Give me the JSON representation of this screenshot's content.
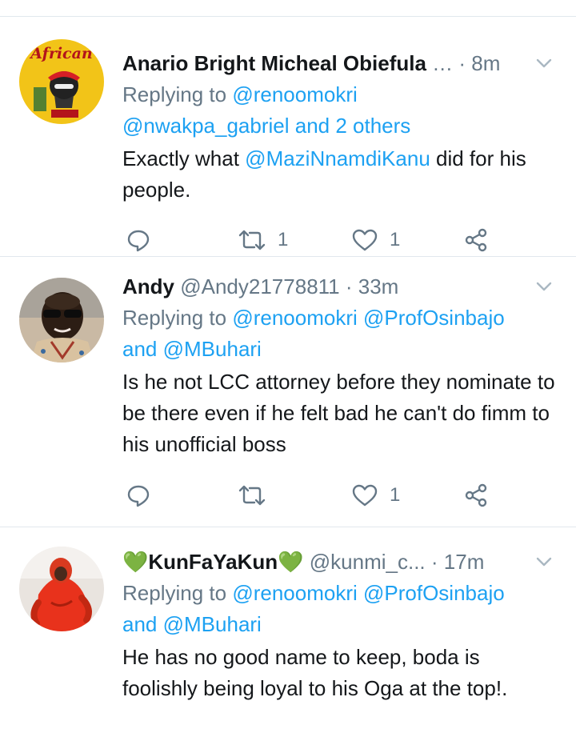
{
  "tweets": [
    {
      "name": "Anario Bright Micheal Obiefula",
      "handle": "…",
      "time": "· 8m",
      "reply_prefix": "Replying to",
      "reply_to_1": "@renoomokri",
      "reply_to_2": "@nwakpa_gabriel and 2 others",
      "reply_to_3": "",
      "text_before": "Exactly what ",
      "text_mention": "@MaziNnamdiKanu",
      "text_after": " did for his people.",
      "retweets": "1",
      "likes": "1",
      "avatar_logo": "African"
    },
    {
      "name": "Andy",
      "handle": "@Andy21778811",
      "time": "· 33m",
      "reply_prefix": "Replying to",
      "reply_to_1": "@renoomokri",
      "reply_to_2": "@ProfOsinbajo",
      "reply_and": "and",
      "reply_to_3": "@MBuhari",
      "text": "Is he not LCC attorney before they nominate to be there even if he felt bad he can't do fimm to his unofficial boss",
      "retweets": "",
      "likes": "1"
    },
    {
      "name": "💚KunFaYaKun💚",
      "handle": "@kunmi_c...",
      "time": "· 17m",
      "reply_prefix": "Replying to",
      "reply_to_1": "@renoomokri",
      "reply_to_2": "@ProfOsinbajo",
      "reply_and": "and",
      "reply_to_3": "@MBuhari",
      "text": "He has no good name to keep, boda is foolishly being loyal to his Oga at the top!."
    }
  ],
  "icons": [
    "reply-icon",
    "retweet-icon",
    "like-icon",
    "share-icon",
    "chevron-down-icon"
  ],
  "colors": {
    "link": "#1da1f2",
    "secondary": "#657786",
    "divider": "#e1e8ed"
  }
}
